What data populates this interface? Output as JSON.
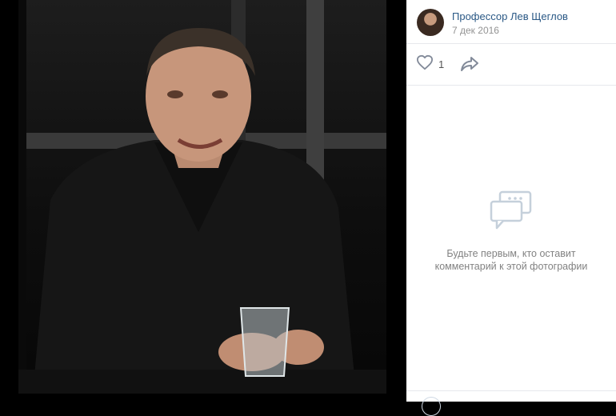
{
  "post": {
    "author_name": "Профессор Лев Щеглов",
    "date": "7 дек 2016",
    "likes_count": "1"
  },
  "comments": {
    "empty_line1": "Будьте первым, кто оставит",
    "empty_line2": "комментарий к этой фотографии"
  },
  "icons": {
    "like": "heart-icon",
    "share": "share-arrow-icon",
    "empty_comments": "comment-bubble-icon"
  },
  "colors": {
    "link": "#2a5885",
    "muted": "#939393",
    "icon": "#828a99",
    "empty_icon": "#c5d0db"
  }
}
